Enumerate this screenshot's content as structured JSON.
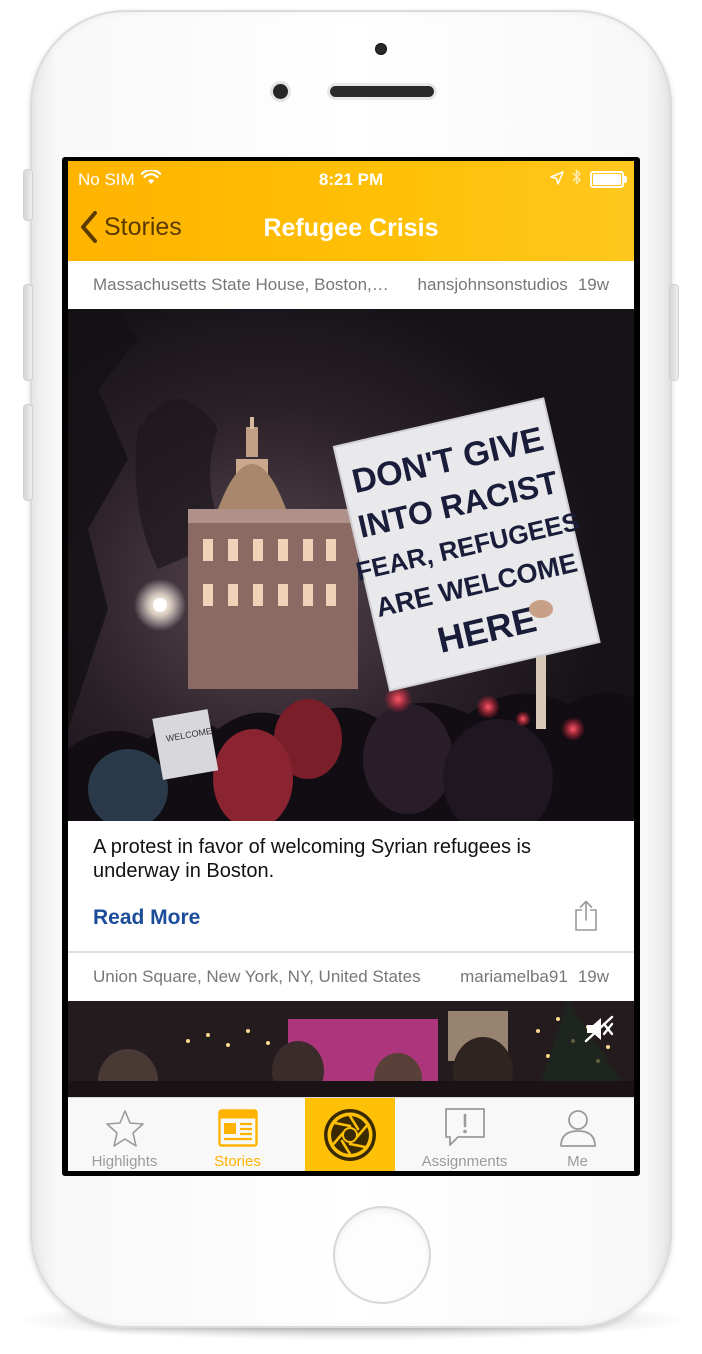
{
  "status_bar": {
    "carrier": "No SIM",
    "time": "8:21 PM"
  },
  "nav": {
    "back_label": "Stories",
    "title": "Refugee Crisis"
  },
  "posts": [
    {
      "location": "Massachusetts State House, Boston, MA, United States",
      "user": "hansjohnsonstudios",
      "age": "19w",
      "caption": "A protest in favor of welcoming Syrian refugees is underway in Boston.",
      "read_more": "Read More",
      "sign_text": [
        "DON'T GIVE",
        "INTO RACIST",
        "FEAR, REFUGEES",
        "ARE WELCOME",
        "HERE"
      ]
    },
    {
      "location": "Union Square, New York, NY, United States",
      "user": "mariamelba91",
      "age": "19w"
    }
  ],
  "tabs": [
    {
      "label": "Highlights",
      "icon": "star-icon"
    },
    {
      "label": "Stories",
      "icon": "newspaper-icon",
      "active": true
    },
    {
      "label": "",
      "icon": "camera-shutter-icon"
    },
    {
      "label": "Assignments",
      "icon": "alert-bubble-icon"
    },
    {
      "label": "Me",
      "icon": "person-icon"
    }
  ],
  "colors": {
    "accent": "#ffc107",
    "link": "#1a4c9a"
  }
}
